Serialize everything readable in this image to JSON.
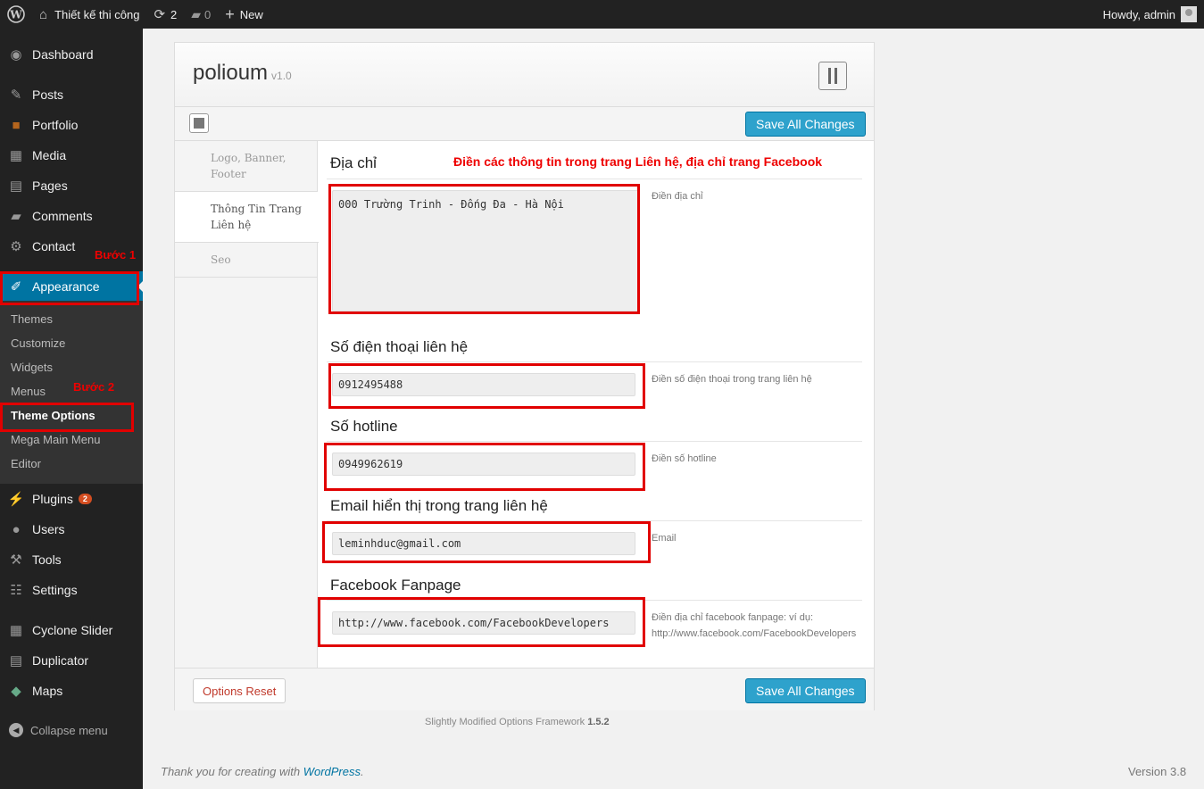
{
  "adminbar": {
    "site_name": "Thiết kế thi công",
    "updates_count": "2",
    "comments_count": "0",
    "new_label": "New",
    "howdy": "Howdy, admin"
  },
  "sidebar": {
    "items": [
      {
        "label": "Dashboard",
        "icon": "dashboard-icon"
      },
      {
        "label": "Posts",
        "icon": "pin-icon"
      },
      {
        "label": "Portfolio",
        "icon": "briefcase-icon"
      },
      {
        "label": "Media",
        "icon": "media-icon"
      },
      {
        "label": "Pages",
        "icon": "pages-icon"
      },
      {
        "label": "Comments",
        "icon": "comment-icon"
      },
      {
        "label": "Contact",
        "icon": "gear-icon"
      },
      {
        "label": "Appearance",
        "icon": "brush-icon"
      },
      {
        "label": "Plugins",
        "icon": "plug-icon",
        "badge": "2"
      },
      {
        "label": "Users",
        "icon": "user-icon"
      },
      {
        "label": "Tools",
        "icon": "wrench-icon"
      },
      {
        "label": "Settings",
        "icon": "settings-icon"
      },
      {
        "label": "Cyclone Slider",
        "icon": "media-icon"
      },
      {
        "label": "Duplicator",
        "icon": "pages-icon"
      },
      {
        "label": "Maps",
        "icon": "map-icon"
      }
    ],
    "submenu": [
      "Themes",
      "Customize",
      "Widgets",
      "Menus",
      "Theme Options",
      "Mega Main Menu",
      "Editor"
    ],
    "collapse_label": "Collapse menu"
  },
  "annotations": {
    "step1": "Bước 1",
    "step2": "Bước 2",
    "note": "Điền các thông tin trong trang Liên hệ, địa chỉ trang Facebook"
  },
  "panel": {
    "title": "polioum",
    "version": "v1.0",
    "save_label": "Save All Changes",
    "reset_label": "Options Reset",
    "tabs": [
      "Logo, Banner, Footer",
      "Thông Tin Trang Liên hệ",
      "Seo"
    ],
    "sections": [
      {
        "title": "Địa chỉ",
        "value": "000 Trường Trinh - Đống Đa - Hà Nội",
        "desc": "Điền địa chỉ"
      },
      {
        "title": "Số điện thoại liên hệ",
        "value": "0912495488",
        "desc": "Điền số điện thoại trong trang liên hệ"
      },
      {
        "title": "Số hotline",
        "value": "0949962619",
        "desc": "Điền số hotline"
      },
      {
        "title": "Email hiển thị trong trang liên hệ",
        "value": "leminhduc@gmail.com",
        "desc": "Email"
      },
      {
        "title": "Facebook Fanpage",
        "value": "http://www.facebook.com/FacebookDevelopers",
        "desc_line1": "Điền địa chỉ facebook fanpage: ví dụ:",
        "desc_line2": "http://www.facebook.com/FacebookDevelopers"
      }
    ]
  },
  "framework": {
    "name": "Slightly Modified Options Framework",
    "version": "1.5.2"
  },
  "footer": {
    "thanks": "Thank you for creating with ",
    "wp_link": "WordPress",
    "period": ".",
    "version": "Version 3.8"
  },
  "colors": {
    "accent": "#0074a2",
    "button": "#2ea2cc",
    "annotation": "#e10000"
  }
}
